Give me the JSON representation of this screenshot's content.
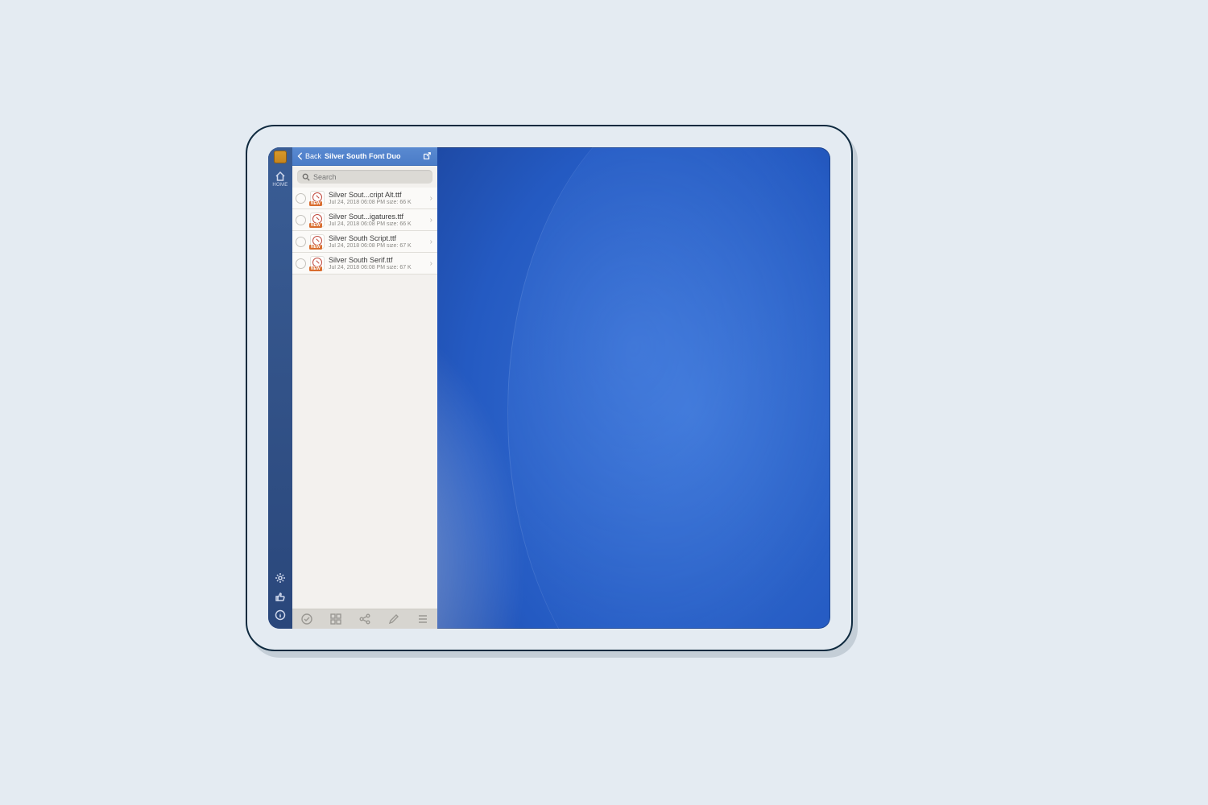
{
  "rail": {
    "home_label": "HOME"
  },
  "titlebar": {
    "back_label": "Back",
    "title": "Silver South Font Duo"
  },
  "search": {
    "placeholder": "Search",
    "value": ""
  },
  "files": [
    {
      "name": "Silver Sout...cript Alt.ttf",
      "meta": "Jul 24, 2018 06:08 PM  size: 66 K",
      "badge": "NEW"
    },
    {
      "name": "Silver Sout...igatures.ttf",
      "meta": "Jul 24, 2018 06:08 PM  size: 66 K",
      "badge": "NEW"
    },
    {
      "name": "Silver South Script.ttf",
      "meta": "Jul 24, 2018 06:08 PM  size: 67 K",
      "badge": "NEW"
    },
    {
      "name": "Silver South Serif.ttf",
      "meta": "Jul 24, 2018 06:08 PM  size: 67 K",
      "badge": "NEW"
    }
  ]
}
